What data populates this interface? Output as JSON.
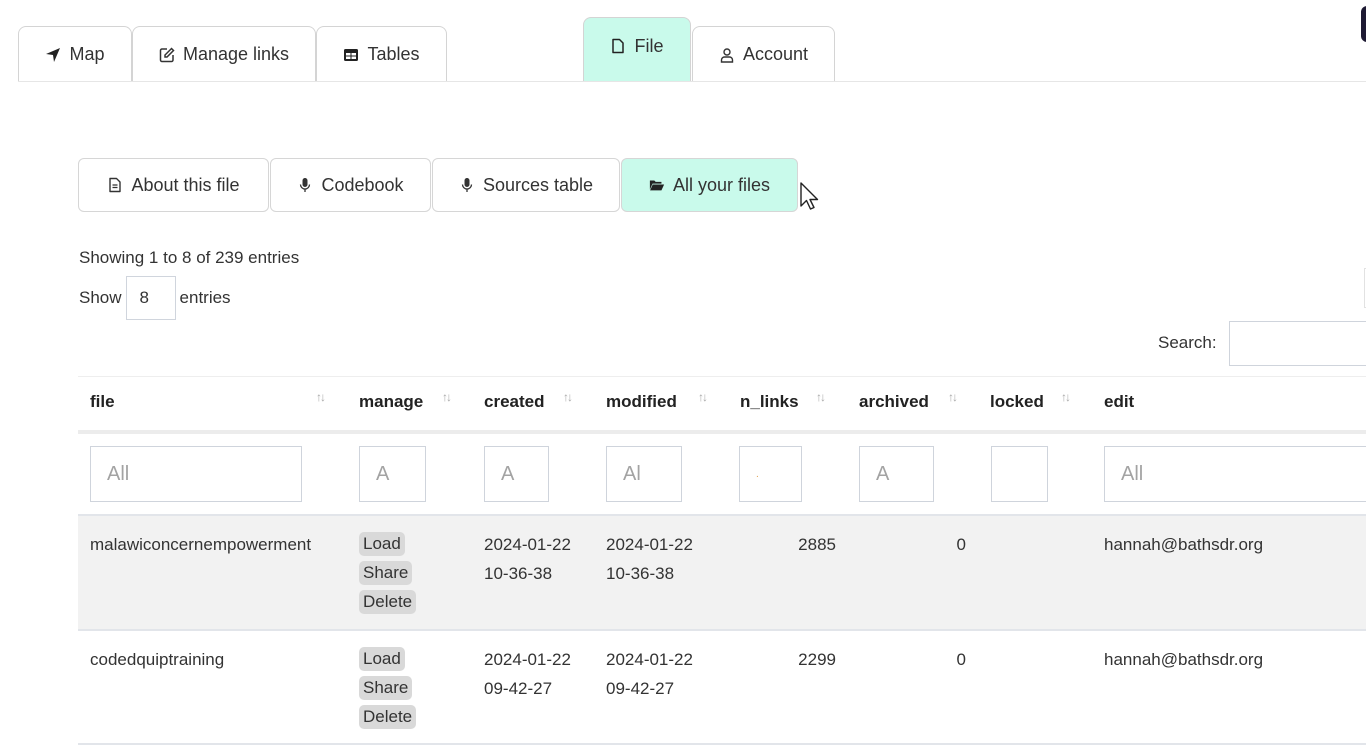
{
  "top_tabs": [
    {
      "label": "Map",
      "icon": "location-arrow-icon",
      "active": false
    },
    {
      "label": "Manage links",
      "icon": "edit-icon",
      "active": false
    },
    {
      "label": "Tables",
      "icon": "table-icon",
      "active": false
    },
    {
      "label": "File",
      "icon": "file-icon",
      "active": true
    },
    {
      "label": "Account",
      "icon": "user-icon",
      "active": false
    }
  ],
  "sub_tabs": [
    {
      "label": "About this file",
      "icon": "file-text-icon",
      "active": false
    },
    {
      "label": "Codebook",
      "icon": "microphone-icon",
      "active": false
    },
    {
      "label": "Sources table",
      "icon": "microphone-icon",
      "active": false
    },
    {
      "label": "All your files",
      "icon": "folder-open-icon",
      "active": true
    }
  ],
  "table_info": "Showing 1 to 8 of 239 entries",
  "length_control": {
    "prefix": "Show",
    "value": "8",
    "suffix": "entries"
  },
  "search": {
    "label": "Search:",
    "value": ""
  },
  "columns": [
    {
      "label": "file",
      "sortable": true,
      "filter": "All"
    },
    {
      "label": "manage",
      "sortable": true,
      "filter": "A"
    },
    {
      "label": "created",
      "sortable": true,
      "filter": "A"
    },
    {
      "label": "modified",
      "sortable": true,
      "filter": "Al"
    },
    {
      "label": "n_links",
      "sortable": true,
      "filter": "."
    },
    {
      "label": "archived",
      "sortable": true,
      "filter": "A"
    },
    {
      "label": "locked",
      "sortable": true,
      "filter": ""
    },
    {
      "label": "edit",
      "sortable": false,
      "filter": "All"
    }
  ],
  "row_actions": [
    "Load",
    "Share",
    "Delete"
  ],
  "rows": [
    {
      "file": "malawiconcernempowerment",
      "created_date": "2024-01-22",
      "created_time": "10-36-38",
      "modified_date": "2024-01-22",
      "modified_time": "10-36-38",
      "n_links": "2885",
      "archived": "0",
      "locked": "",
      "edit": "hannah@bathsdr.org"
    },
    {
      "file": "codedquiptraining",
      "created_date": "2024-01-22",
      "created_time": "09-42-27",
      "modified_date": "2024-01-22",
      "modified_time": "09-42-27",
      "n_links": "2299",
      "archived": "0",
      "locked": "",
      "edit": "hannah@bathsdr.org"
    }
  ],
  "colors": {
    "active_tab": "#c9faeb",
    "action_button": "#d9d9d9",
    "odd_row": "#f2f2f2"
  }
}
